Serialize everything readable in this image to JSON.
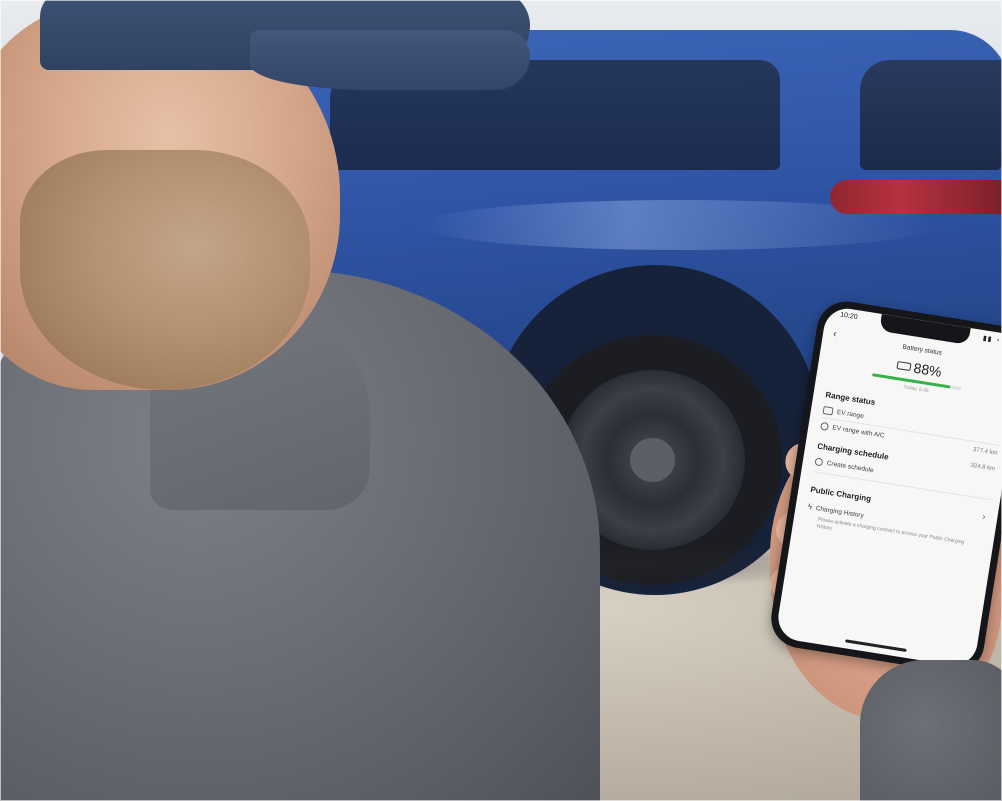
{
  "phone": {
    "status_time": "10:20",
    "status_icons": "▮▮ ◔ ▭",
    "back_glyph": "‹",
    "title": "Battery status",
    "battery_percent": "88%",
    "battery_level": 0.88,
    "battery_color": "#35b34a",
    "battery_subtext": "Today, 9:46",
    "range_status": {
      "title": "Range status",
      "items": [
        {
          "label": "EV range",
          "value": "",
          "icon": "car-icon"
        },
        {
          "label": "EV range with A/C",
          "value": "377.4 km",
          "icon": "ac-icon"
        }
      ]
    },
    "charging_schedule": {
      "title": "Charging schedule",
      "side_value": "324.8 km",
      "items": [
        {
          "label": "Create schedule",
          "icon": "clock-icon"
        }
      ]
    },
    "public_charging": {
      "title": "Public Charging",
      "chevron": "›",
      "items": [
        {
          "label": "Charging History",
          "icon": "bolt-icon"
        }
      ],
      "description": "Please activate a charging contract to access your Public Charging History"
    }
  }
}
